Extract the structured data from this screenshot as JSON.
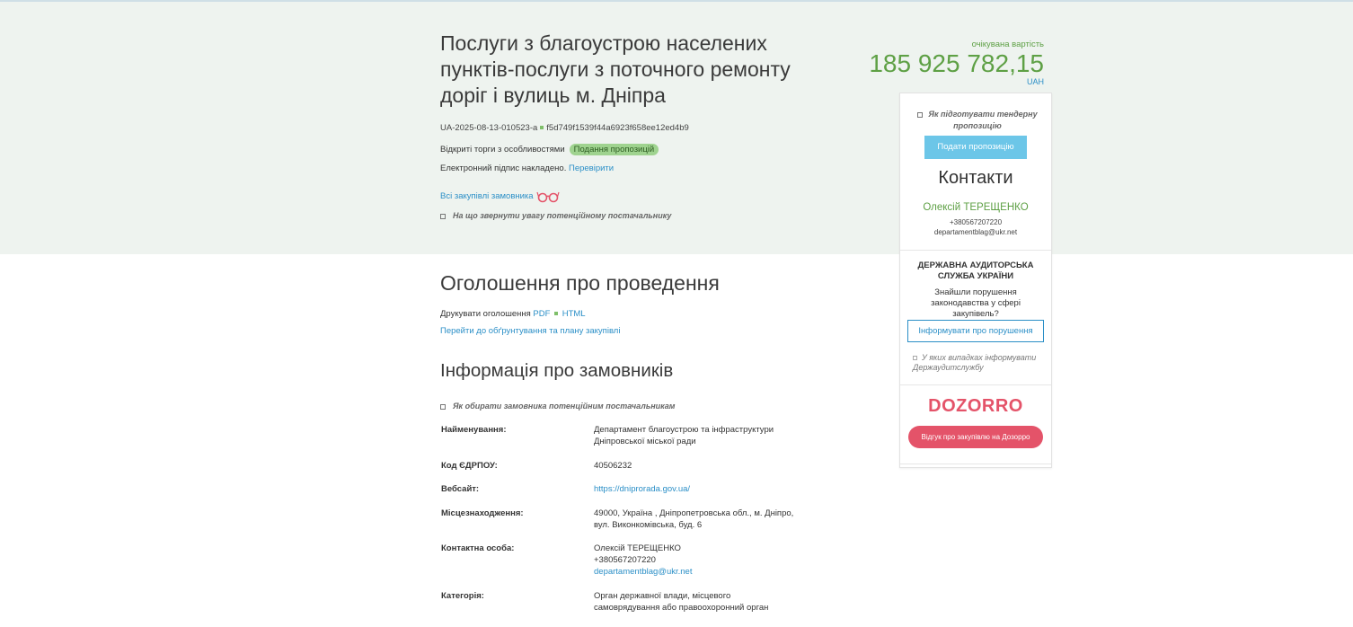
{
  "tender": {
    "title": "Послуги з благоустрою населених пунктів-послуги з поточного ремонту доріг і вулиць м. Дніпра",
    "id": "UA-2025-08-13-010523-a",
    "hash": "f5d749f1539f44a6923f658ee12ed4b9",
    "procedure_type": "Відкриті торги з особливостями",
    "status_badge": "Подання пропозицій",
    "esign_text": "Електронний підпис накладено.",
    "esign_link": "Перевірити",
    "all_procurements_link": "Всі закупівлі замовника",
    "supplier_hint": "На що звернути увагу потенційному постачальнику"
  },
  "price": {
    "label": "очікувана вартість",
    "amount": "185 925 782,15",
    "currency": "UAH"
  },
  "sidebar": {
    "howto": "Як підготувати тендерну пропозицію",
    "submit_button": "Подати пропозицію",
    "contacts_title": "Контакти",
    "contact_name": "Олексій ТЕРЕЩЕНКО",
    "contact_phone": "+380567207220",
    "contact_email": "departamentblag@ukr.net",
    "audit_title": "ДЕРЖАВНА АУДИТОРСЬКА СЛУЖБА УКРАЇНИ",
    "audit_question": "Знайшли порушення законодавства у сфері закупівель?",
    "inform_button": "Інформувати про порушення",
    "audit_hint": "У яких випадках інформувати Держаудитслужбу",
    "dozorro_logo": "DOZORRO",
    "dozorro_button": "Відгук про закупівлю на Дозорро"
  },
  "announcement": {
    "title": "Оголошення про проведення",
    "print_label": "Друкувати оголошення",
    "pdf": "PDF",
    "html": "HTML",
    "plan_link": "Перейти до обґрунтування та плану закупівлі"
  },
  "customer": {
    "title": "Інформація про замовників",
    "hint": "Як обирати замовника потенційним постачальникам",
    "name_label": "Найменування:",
    "name_value": "Департамент благоустрою та інфраструктури Дніпровської міської ради",
    "edrpou_label": "Код ЄДРПОУ:",
    "edrpou_value": "40506232",
    "website_label": "Вебсайт:",
    "website_value": "https://dniprorada.gov.ua/",
    "location_label": "Місцезнаходження:",
    "location_value": "49000, Україна , Дніпропетровська обл., м. Дніпро, вул. Виконкомівська, буд. 6",
    "contact_label": "Контактна особа:",
    "contact_name": "Олексій ТЕРЕЩЕНКО",
    "contact_phone": "+380567207220",
    "contact_email": "departamentblag@ukr.net",
    "category_label": "Категорія:",
    "category_value": "Орган державної влади, місцевого самоврядування або правоохоронний орган"
  },
  "colors": {
    "accent_green": "#5ea045",
    "link_blue": "#2b8fc7",
    "submit_blue": "#6cc6e8",
    "dozorro_red": "#e45369",
    "hero_bg": "#eef3ef"
  }
}
